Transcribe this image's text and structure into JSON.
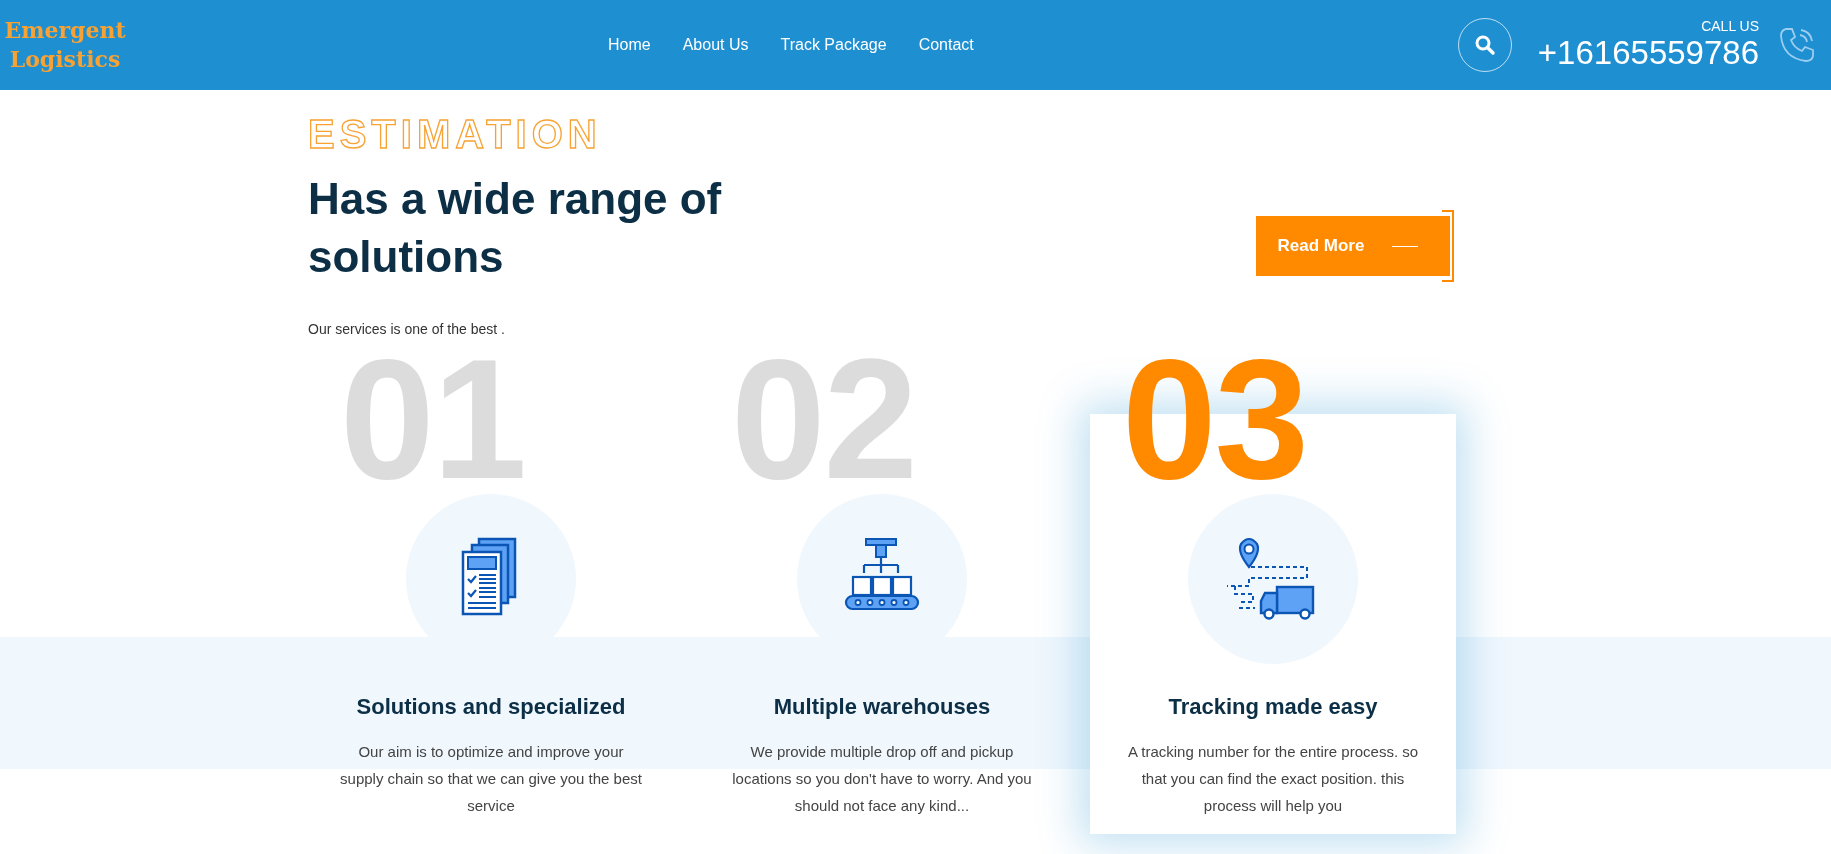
{
  "header": {
    "logo": "Emergent Logistics",
    "nav": [
      {
        "label": "Home"
      },
      {
        "label": "About Us"
      },
      {
        "label": "Track Package"
      },
      {
        "label": "Contact"
      }
    ],
    "call_label": "CALL US",
    "phone": "+16165559786"
  },
  "intro": {
    "eyebrow": "ESTIMATION",
    "heading": "Has a wide range of solutions",
    "text": "Our services is one of the best .",
    "button": "Read More"
  },
  "services": [
    {
      "number": "01",
      "kind": "documents",
      "title": "Solutions and specialized",
      "description": "Our aim is to optimize and improve your supply chain so that we can give you the best service",
      "selected": false
    },
    {
      "number": "02",
      "kind": "warehouse",
      "title": "Multiple warehouses",
      "description": "We provide multiple drop off and pickup locations so you don't have to worry. And you should not face any kind...",
      "selected": false
    },
    {
      "number": "03",
      "kind": "tracking",
      "title": "Tracking made easy",
      "description": "A tracking number for the entire process. so that you can find the exact position. this process will help you",
      "selected": true
    }
  ]
}
